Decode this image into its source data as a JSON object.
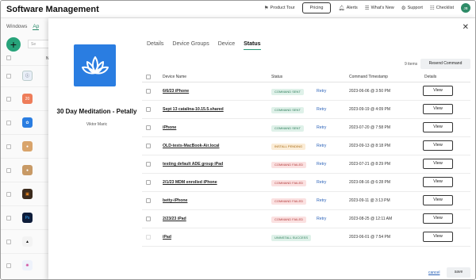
{
  "header": {
    "title": "Software Management",
    "nav": [
      {
        "icon": "product-tour-icon",
        "label": "Product Tour"
      },
      {
        "icon": "bell-icon",
        "label": "Alerts"
      },
      {
        "icon": "whats-new-icon",
        "label": "What's New"
      },
      {
        "icon": "support-icon",
        "label": "Support"
      },
      {
        "icon": "checklist-icon",
        "label": "Checklist"
      }
    ],
    "pricing_label": "Pricing",
    "avatar_initials": "JB"
  },
  "background": {
    "tabs": [
      "Windows",
      "Ap"
    ],
    "search_placeholder": "Se",
    "column_letter": "N"
  },
  "drawer": {
    "app_name": "30 Day Meditation - Petally",
    "vendor": "Viktor Maric",
    "tabs": [
      "Details",
      "Device Groups",
      "Device",
      "Status"
    ],
    "active_tab": "Status",
    "items_count": "9 items",
    "resend_label": "Resend Command",
    "columns": {
      "device_name": "Device Name",
      "status": "Status",
      "timestamp": "Command Timestamp",
      "details": "Details"
    },
    "rows": [
      {
        "device": "6/6/23 iPhone",
        "status": "COMMAND SENT",
        "kind": "sent",
        "retry": "Retry",
        "timestamp": "2023-06-06 @ 3:50 PM",
        "view": "View"
      },
      {
        "device": "Sept 13 catalina-10.15.5.shared",
        "status": "COMMAND SENT",
        "kind": "sent",
        "retry": "Retry",
        "timestamp": "2023-09-19 @ 4:09 PM",
        "view": "View"
      },
      {
        "device": "iPhone",
        "status": "COMMAND SENT",
        "kind": "sent",
        "retry": "Retry",
        "timestamp": "2023-07-20 @ 7:58 PM",
        "view": "View"
      },
      {
        "device": "OLD-tests-MacBook-Air.local",
        "status": "INSTALL PENDING",
        "kind": "pending",
        "retry": "Retry",
        "timestamp": "2023-09-13 @ 8:18 PM",
        "view": "View"
      },
      {
        "device": "testing default ADE group iPad",
        "status": "COMMAND FAILED",
        "kind": "failed",
        "retry": "Retry",
        "timestamp": "2023-07-21 @ 8:29 PM",
        "view": "View"
      },
      {
        "device": "2/1/23 MDM enrolled iPhone",
        "status": "COMMAND FAILED",
        "kind": "failed",
        "retry": "Retry",
        "timestamp": "2023-08-16 @ 6:28 PM",
        "view": "View"
      },
      {
        "device": "betty-iPhone",
        "status": "COMMAND FAILED",
        "kind": "failed",
        "retry": "Retry",
        "timestamp": "2023-09-11 @ 3:13 PM",
        "view": "View"
      },
      {
        "device": "2/23/23 iPad",
        "status": "COMMAND FAILED",
        "kind": "failed",
        "retry": "Retry",
        "timestamp": "2023-08-25 @ 12:11 AM",
        "view": "View"
      },
      {
        "device": "iPad",
        "status": "UNINSTALL SUCCESS",
        "kind": "success",
        "retry": "",
        "timestamp": "2023-06-01 @ 7:54 PM",
        "view": "View"
      }
    ],
    "cancel_label": "cancel",
    "save_label": "save"
  }
}
